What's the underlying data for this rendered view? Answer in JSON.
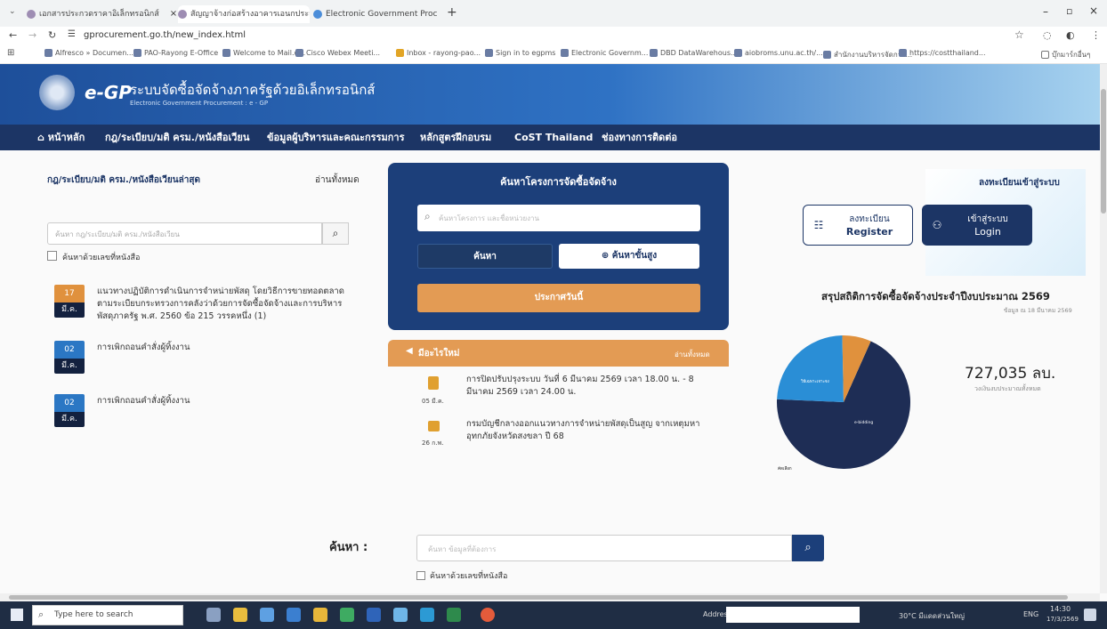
{
  "browser": {
    "tabs": [
      {
        "label": "เอกสารประกวดราคาอิเล็กทรอนิกส์"
      },
      {
        "label": "สัญญาจ้างก่อสร้างอาคารเอนกประสงค์"
      },
      {
        "label": "Electronic Government Procure"
      }
    ],
    "url": "gprocurement.go.th/new_index.html",
    "bookmarks": [
      "Alfresco » Documen...",
      "PAO-Rayong E-Office",
      "Welcome to Mail.d...",
      "Cisco Webex Meeti...",
      "Inbox - rayong-pao...",
      "Sign in to egpms",
      "Electronic Governm...",
      "DBD DataWarehous...",
      "aiobroms.unu.ac.th/...",
      "สำนักงานบริหารจัดการ...",
      "https://costthailand..."
    ],
    "bookmarks_folder": "บุ๊กมาร์กอื่นๆ"
  },
  "site": {
    "logo": "e-GP",
    "title": "ระบบจัดซื้อจัดจ้างภาครัฐด้วยอิเล็กทรอนิกส์",
    "subtitle": "Electronic Government Procurement : e - GP",
    "nav": [
      "หน้าหลัก",
      "กฎ/ระเบียบ/มติ ครม./หนังสือเวียน",
      "ข้อมูลผู้บริหารและคณะกรรมการ",
      "หลักสูตรฝึกอบรม",
      "CoST Thailand",
      "ช่องทางการติดต่อ"
    ]
  },
  "left": {
    "heading": "กฎ/ระเบียบ/มติ ครม./หนังสือเวียนล่าสุด",
    "view_all": "อ่านทั้งหมด",
    "search_placeholder": "ค้นหา กฎ/ระเบียบ/มติ ครม./หนังสือเวียน",
    "checkbox_label": "ค้นหาด้วยเลขที่หนังสือ",
    "items": [
      {
        "day": "17",
        "month": "มี.ค.",
        "text": "แนวทางปฏิบัติการดำเนินการจำหน่ายพัสดุ โดยวิธีการขายทอดตลาด ตามระเบียบกระทรวงการคลังว่าด้วยการจัดซื้อจัดจ้างและการบริหารพัสดุภาครัฐ พ.ศ. 2560 ข้อ 215 วรรคหนึ่ง (1)"
      },
      {
        "day": "02",
        "month": "มี.ค.",
        "text": "การเพิกถอนคำสั่งผู้ทิ้งงาน"
      },
      {
        "day": "02",
        "month": "มี.ค.",
        "text": "การเพิกถอนคำสั่งผู้ทิ้งงาน"
      }
    ]
  },
  "center": {
    "title": "ค้นหาโครงการจัดซื้อจัดจ้าง",
    "search_placeholder": "ค้นหาโครงการ และชื่อหน่วยงาน",
    "search_button": "ค้นหา",
    "advanced_button": "ค้นหาขั้นสูง",
    "announce_button": "ประกาศวันนี้",
    "news_heading": "มีอะไรใหม่",
    "news_view_all": "อ่านทั้งหมด",
    "news": [
      {
        "date": "05 มี.ค.",
        "text": "การปิดปรับปรุงระบบ วันที่ 6 มีนาคม 2569 เวลา 18.00 น. - 8 มีนาคม 2569 เวลา 24.00 น."
      },
      {
        "date": "26 ก.พ.",
        "text": "กรมบัญชีกลางออกแนวทางการจำหน่ายพัสดุเป็นสูญ จากเหตุมหาอุทกภัยจังหวัดสงขลา ปี 68"
      }
    ]
  },
  "right": {
    "register_link": "ลงทะเบียนเข้าสู่ระบบ",
    "register_th": "ลงทะเบียน",
    "register_en": "Register",
    "login_th": "เข้าสู่ระบบ",
    "login_en": "Login",
    "stats_title": "สรุปสถิติการจัดซื้อจัดจ้างประจำปีงบประมาณ 2569",
    "stats_date": "ข้อมูล ณ 18 มีนาคม 2569",
    "amount": "727,035 ลบ.",
    "amount_caption": "วงเงินงบประมาณทั้งหมด",
    "pie_labels": [
      "วิธีเฉพาะเจาะจง",
      "e-bidding",
      "คัดเลือก"
    ]
  },
  "chart_data": {
    "type": "pie",
    "categories": [
      "e-bidding",
      "วิธีเฉพาะเจาะจง",
      "คัดเลือก"
    ],
    "values": [
      69,
      24,
      7
    ],
    "colors": [
      "#1e2d55",
      "#2a8ed6",
      "#e0913d"
    ]
  },
  "bottom": {
    "label": "ค้นหา :",
    "placeholder": "ค้นหา ข้อมูลที่ต้องการ",
    "checkbox_label": "ค้นหาด้วยเลขที่หนังสือ"
  },
  "taskbar": {
    "search_placeholder": "Type here to search",
    "address_label": "Address",
    "weather": "30°C มีแดดส่วนใหญ่",
    "lang": "ENG",
    "time": "14:30",
    "date": "17/3/2569"
  }
}
